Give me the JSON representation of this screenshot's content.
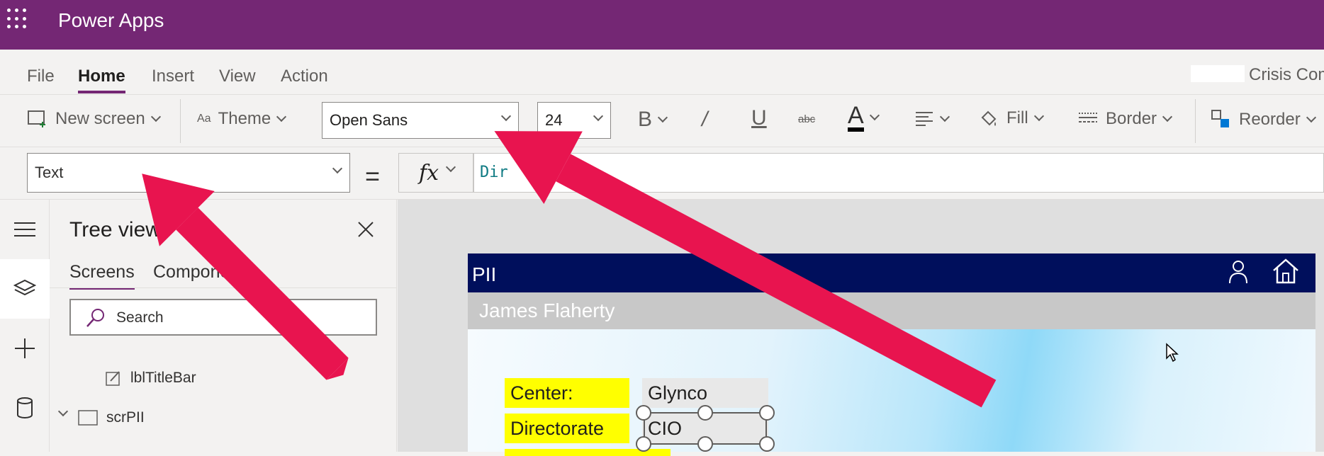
{
  "app": {
    "title": "Power Apps",
    "app_name": "Crisis Com"
  },
  "menu": {
    "items": [
      "File",
      "Home",
      "Insert",
      "View",
      "Action"
    ],
    "active": "Home"
  },
  "ribbon": {
    "new_screen": "New screen",
    "theme": "Theme",
    "font": "Open Sans",
    "font_size": "24",
    "fill": "Fill",
    "border": "Border",
    "reorder": "Reorder",
    "icons": [
      "bold-icon",
      "italic-icon",
      "underline-icon",
      "strikethrough-icon",
      "font-color-icon",
      "align-icon",
      "fill-icon",
      "border-icon",
      "reorder-icon"
    ]
  },
  "formula_bar": {
    "property": "Text",
    "equals": "=",
    "fx": "fx",
    "formula": "Dir"
  },
  "tree_view": {
    "title": "Tree view",
    "tabs": [
      "Screens",
      "Components"
    ],
    "active_tab": "Screens",
    "search_placeholder": "Search",
    "nodes": [
      {
        "label": "lblTitleBar",
        "type": "label"
      },
      {
        "label": "scrPII",
        "type": "screen",
        "expanded": true
      }
    ]
  },
  "canvas": {
    "header_title": "PII",
    "subheader": "James Flaherty",
    "fields": [
      {
        "label": "Center:",
        "value": "Glynco"
      },
      {
        "label": "Directorate",
        "value": "CIO"
      }
    ],
    "header_icons": [
      "person-icon",
      "home-icon"
    ]
  },
  "colors": {
    "brand": "#742774",
    "app_header": "#000f5c",
    "arrow": "#e8144f",
    "label_bg": "#ffff00"
  }
}
